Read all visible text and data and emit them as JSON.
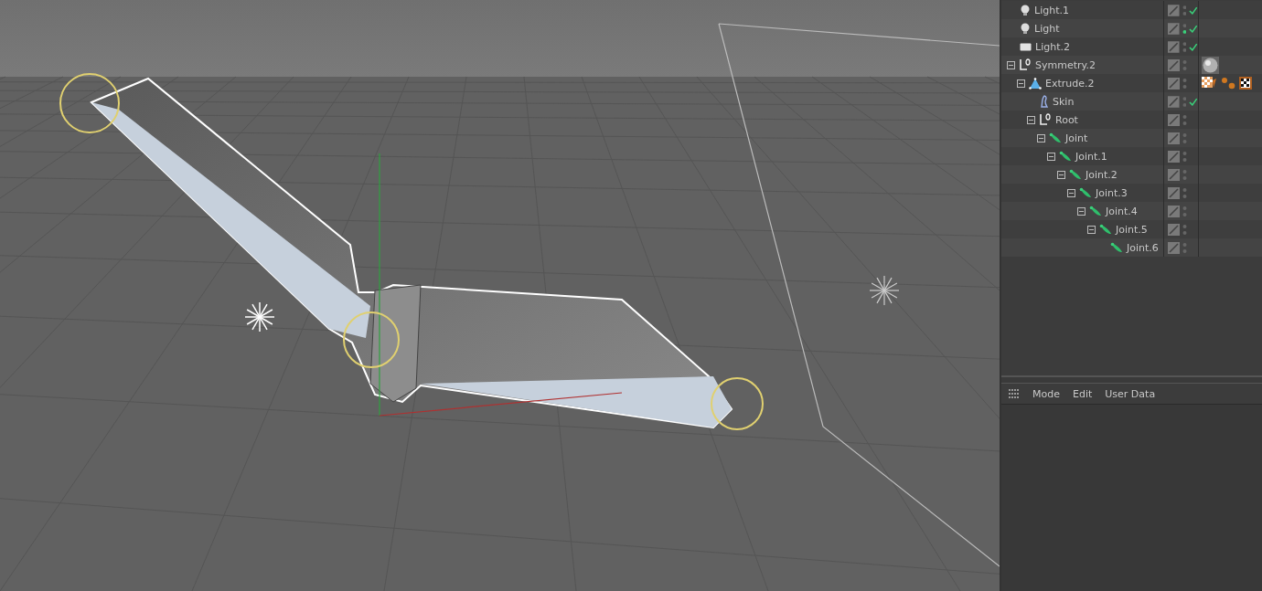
{
  "objects": [
    {
      "name": "Light.1",
      "kind": "bulb",
      "checked": true,
      "editor_on": false
    },
    {
      "name": "Light",
      "kind": "bulb",
      "checked": true,
      "editor_on": true
    },
    {
      "name": "Light.2",
      "kind": "panel",
      "checked": true,
      "editor_on": false
    },
    {
      "name": "Symmetry.2",
      "kind": "axis",
      "checked": false,
      "editor_on": false,
      "expanded": true,
      "tags": [
        {
          "kind": "sphere"
        }
      ],
      "children": [
        {
          "name": "Extrude.2",
          "kind": "extrude",
          "checked": false,
          "editor_on": false,
          "expanded": true,
          "tags": [
            {
              "kind": "texture"
            },
            {
              "kind": "dots"
            },
            {
              "kind": "checker"
            }
          ],
          "children": [
            {
              "name": "Skin",
              "kind": "skin",
              "checked": true,
              "editor_on": false
            },
            {
              "name": "Root",
              "kind": "axis",
              "checked": false,
              "editor_on": false,
              "expanded": true,
              "children": [
                {
                  "name": "Joint",
                  "kind": "joint",
                  "checked": false,
                  "editor_on": false,
                  "expanded": true,
                  "children": [
                    {
                      "name": "Joint.1",
                      "kind": "joint",
                      "checked": false,
                      "editor_on": false,
                      "expanded": true,
                      "children": [
                        {
                          "name": "Joint.2",
                          "kind": "joint",
                          "checked": false,
                          "editor_on": false,
                          "expanded": true,
                          "children": [
                            {
                              "name": "Joint.3",
                              "kind": "joint",
                              "checked": false,
                              "editor_on": false,
                              "expanded": true,
                              "children": [
                                {
                                  "name": "Joint.4",
                                  "kind": "joint",
                                  "checked": false,
                                  "editor_on": false,
                                  "expanded": true,
                                  "children": [
                                    {
                                      "name": "Joint.5",
                                      "kind": "joint",
                                      "checked": false,
                                      "editor_on": false,
                                      "expanded": true,
                                      "children": [
                                        {
                                          "name": "Joint.6",
                                          "kind": "joint",
                                          "checked": false,
                                          "editor_on": false
                                        }
                                      ]
                                    }
                                  ]
                                }
                              ]
                            }
                          ]
                        }
                      ]
                    }
                  ]
                }
              ]
            }
          ]
        }
      ]
    }
  ],
  "attributes": {
    "menu": [
      "Mode",
      "Edit",
      "User Data"
    ]
  }
}
